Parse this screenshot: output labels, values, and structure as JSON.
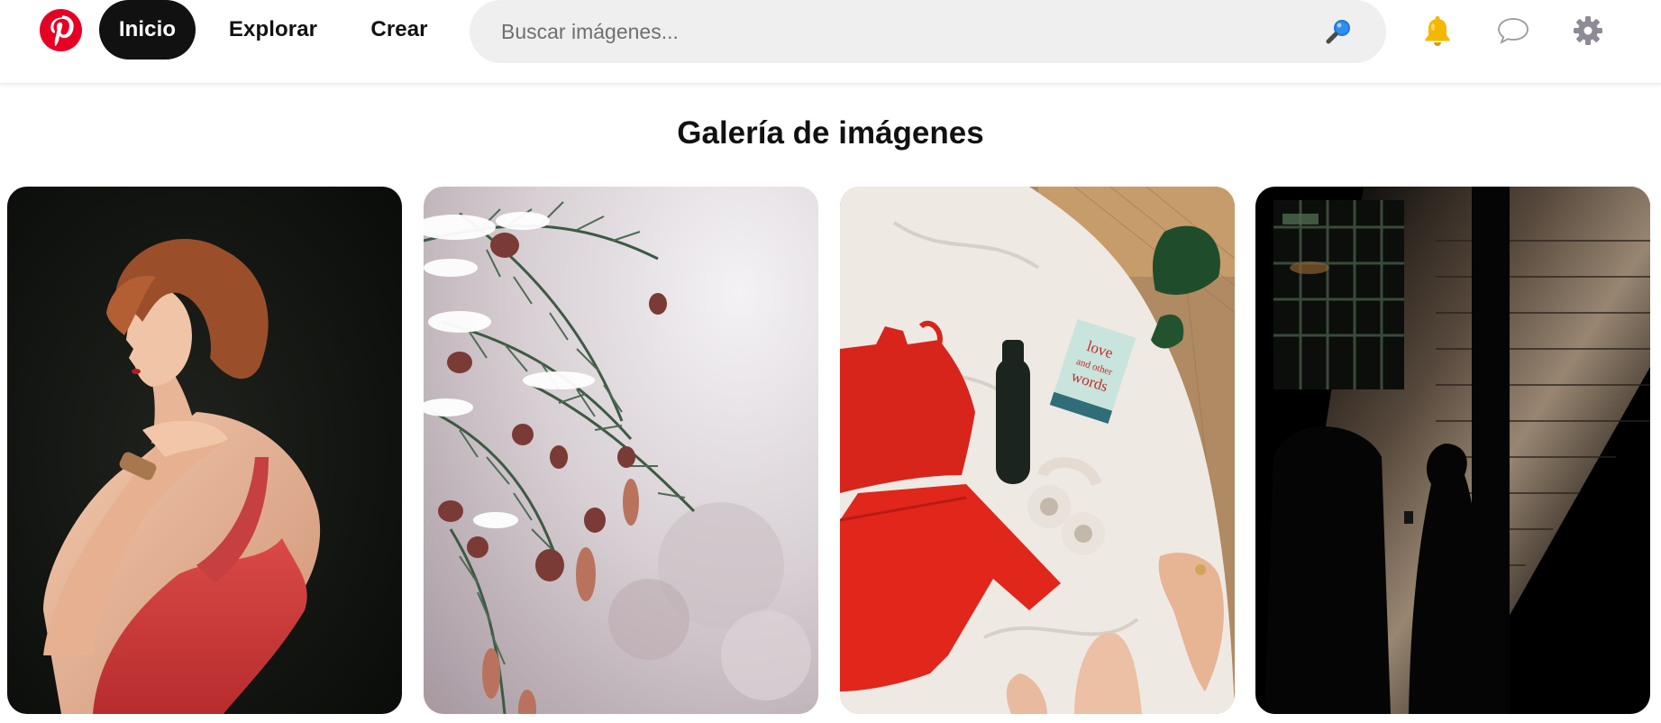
{
  "nav": {
    "home_label": "Inicio",
    "explore_label": "Explorar",
    "create_label": "Crear"
  },
  "search": {
    "placeholder": "Buscar imágenes..."
  },
  "gallery": {
    "title": "Galería de imágenes",
    "images": [
      {
        "subject": "woman-red-dress-portrait"
      },
      {
        "subject": "snowy-evergreen-branch"
      },
      {
        "subject": "red-outfit-flatlay-bed"
      },
      {
        "subject": "shadow-silhouette-brick-wall"
      }
    ]
  },
  "book": {
    "title_line1": "love",
    "title_line2": "and other",
    "title_line3": "words"
  },
  "colors": {
    "brand": "#e60023",
    "nav_active_bg": "#111111",
    "search_bg": "#efefef",
    "bell": "#f5b800"
  },
  "icons": [
    "pinterest-logo-icon",
    "search-icon",
    "bell-icon",
    "chat-icon",
    "gear-icon"
  ]
}
